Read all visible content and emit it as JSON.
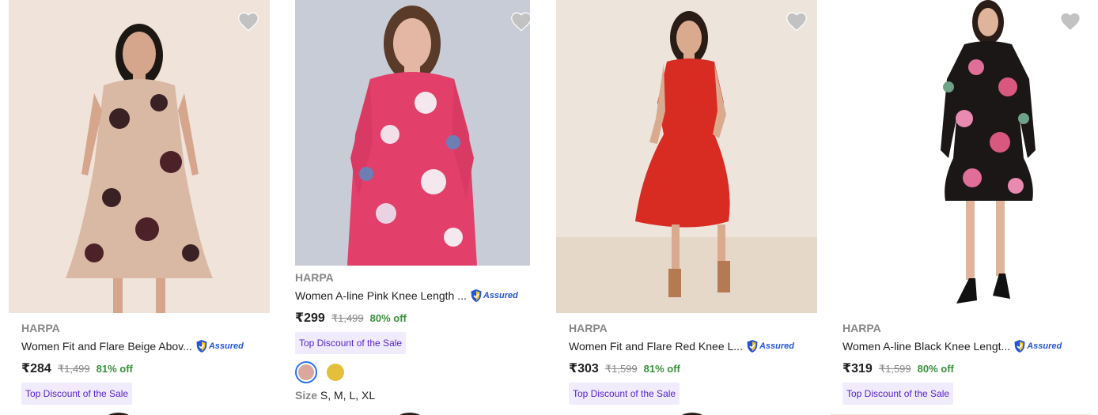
{
  "products": [
    {
      "brand": "HARPA",
      "title": "Women Fit and Flare Beige Abov...",
      "assured": "Assured",
      "price": "₹284",
      "mrp": "₹1,499",
      "discount": "81% off",
      "badge": "Top Discount of the Sale",
      "icon": "heart-icon"
    },
    {
      "brand": "HARPA",
      "title": "Women A-line Pink Knee Length ...",
      "assured": "Assured",
      "price": "₹299",
      "mrp": "₹1,499",
      "discount": "80% off",
      "badge": "Top Discount of the Sale",
      "swatches": [
        "#d9a79c",
        "#e3bf3b"
      ],
      "size_label": "Size",
      "sizes": "S, M, L, XL",
      "icon": "heart-icon"
    },
    {
      "brand": "HARPA",
      "title": "Women Fit and Flare Red Knee L...",
      "assured": "Assured",
      "price": "₹303",
      "mrp": "₹1,599",
      "discount": "81% off",
      "badge": "Top Discount of the Sale",
      "icon": "heart-icon"
    },
    {
      "brand": "HARPA",
      "title": "Women A-line Black Knee Lengt...",
      "assured": "Assured",
      "price": "₹319",
      "mrp": "₹1,599",
      "discount": "80% off",
      "badge": "Top Discount of the Sale",
      "icon": "heart-icon"
    }
  ],
  "colors": {
    "brand_text": "#878787",
    "discount_green": "#388e3c",
    "badge_bg": "#f1ecfd",
    "badge_text": "#5522cc",
    "assured_blue": "#2455d6",
    "swatch_selected_ring": "#2874f0"
  }
}
